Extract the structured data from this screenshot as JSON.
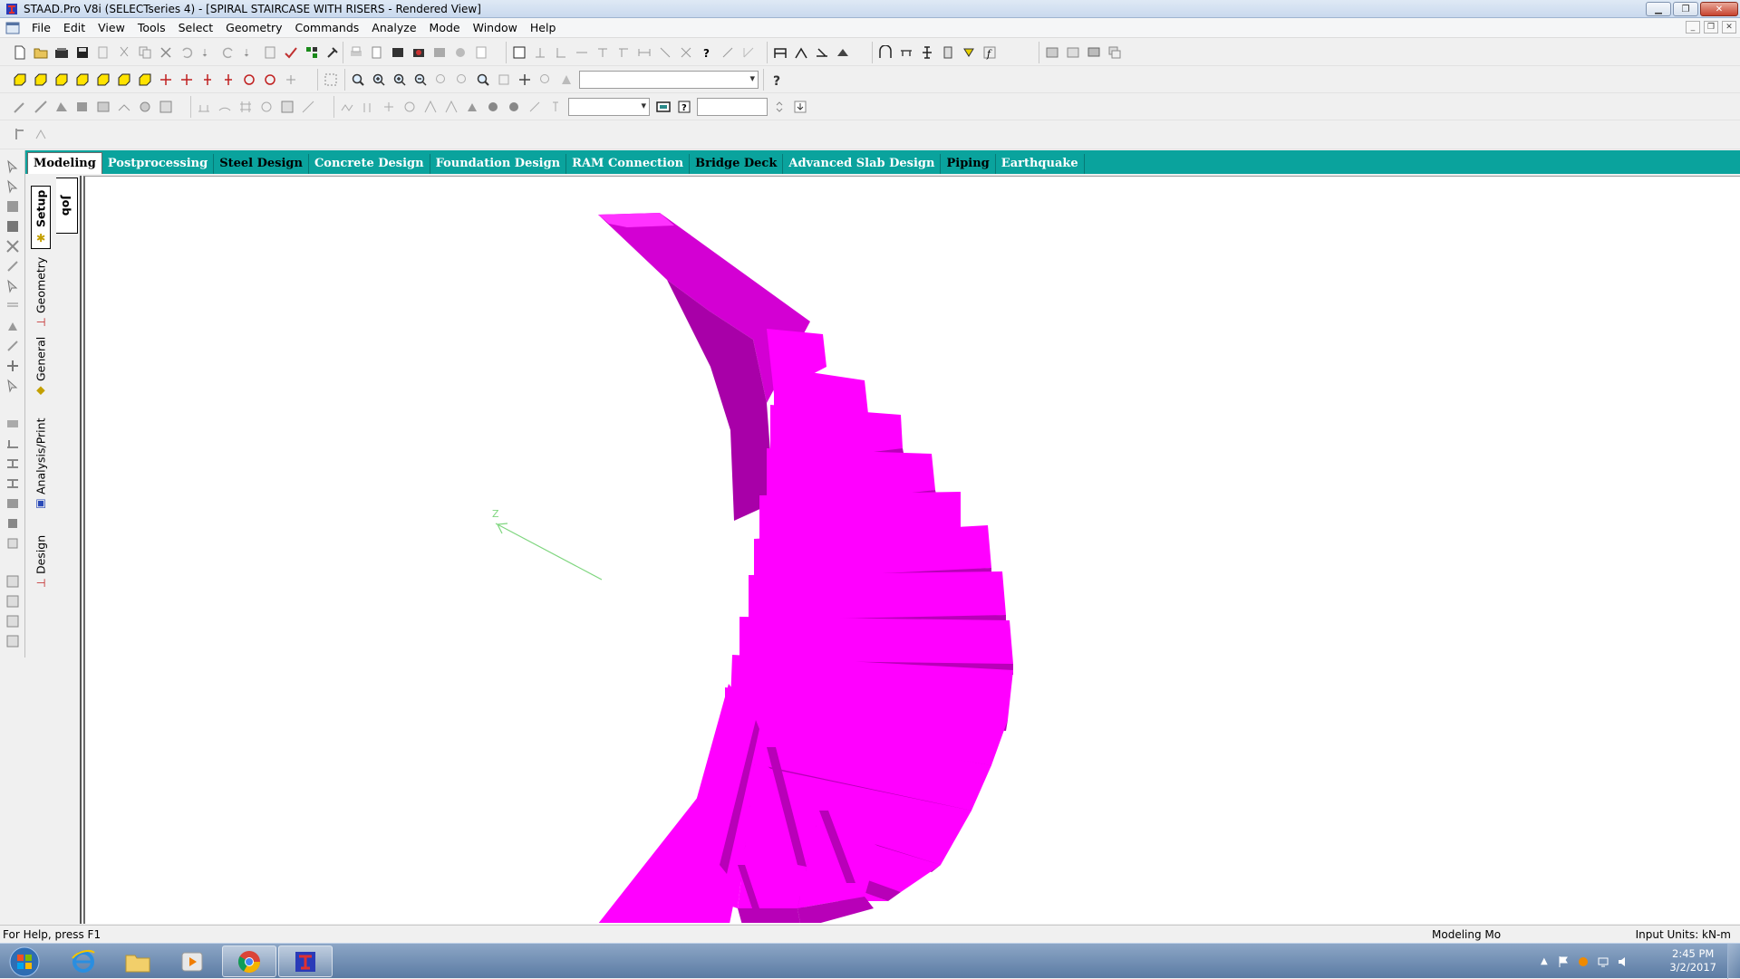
{
  "window": {
    "title": "STAAD.Pro V8i (SELECTseries 4) - [SPIRAL STAIRCASE WITH RISERS - Rendered View]",
    "controls": [
      "minimize-icon",
      "restore-icon",
      "close-icon"
    ]
  },
  "menubar": {
    "items": [
      "File",
      "Edit",
      "View",
      "Tools",
      "Select",
      "Geometry",
      "Commands",
      "Analyze",
      "Mode",
      "Window",
      "Help"
    ]
  },
  "toolbars": {
    "view_combo_value": "",
    "size_combo_value": "",
    "text_field_value": ""
  },
  "tabs": {
    "items": [
      {
        "label": "Modeling",
        "active": true
      },
      {
        "label": "Postprocessing",
        "active": false
      },
      {
        "label": "Steel Design",
        "active": false
      },
      {
        "label": "Concrete Design",
        "active": false
      },
      {
        "label": "Foundation Design",
        "active": false
      },
      {
        "label": "RAM Connection",
        "active": false
      },
      {
        "label": "Bridge Deck",
        "active": false
      },
      {
        "label": "Advanced Slab Design",
        "active": false
      },
      {
        "label": "Piping",
        "active": false
      },
      {
        "label": "Earthquake",
        "active": false
      }
    ]
  },
  "page_control": {
    "job_label": "Job",
    "items": [
      "Setup",
      "Geometry",
      "General",
      "Analysis/Print",
      "Design"
    ],
    "active": "Setup"
  },
  "viewport": {
    "axis_label": "Z",
    "model_color": "#ff00ff",
    "model_shade": "#b800b8",
    "axis_color": "#7fd67f"
  },
  "statusbar": {
    "help": "For Help, press F1",
    "mode": "Modeling Mo",
    "units": "Input Units:  kN-m"
  },
  "taskbar": {
    "clock_time": "2:45 PM",
    "clock_date": "3/2/2017"
  }
}
